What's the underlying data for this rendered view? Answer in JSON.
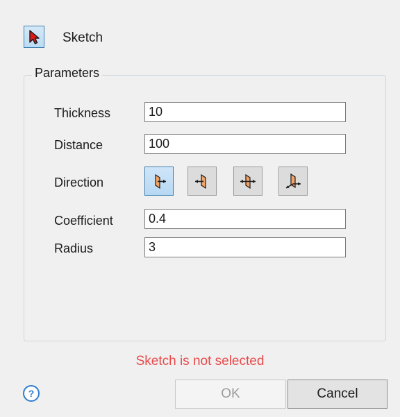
{
  "selector": {
    "label": "Sketch",
    "icon": "red-arrow-cursor-icon"
  },
  "parameters": {
    "title": "Parameters",
    "thickness": {
      "label": "Thickness",
      "value": "10"
    },
    "distance": {
      "label": "Distance",
      "value": "100"
    },
    "direction": {
      "label": "Direction",
      "options": [
        "forward",
        "reverse",
        "both-sides",
        "symmetric"
      ],
      "selected": "forward"
    },
    "coefficient": {
      "label": "Coefficient",
      "value": "0.4"
    },
    "radius": {
      "label": "Radius",
      "value": "3"
    }
  },
  "status": {
    "message": "Sketch is not selected",
    "color": "#e84a4a"
  },
  "footer": {
    "help_icon": "question-mark-icon",
    "help_glyph": "?",
    "ok_label": "OK",
    "cancel_label": "Cancel"
  }
}
